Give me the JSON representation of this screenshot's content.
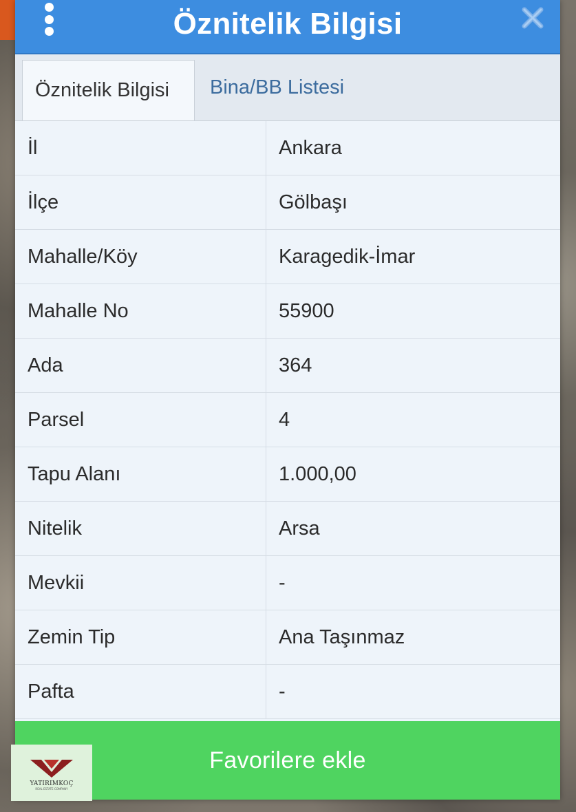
{
  "dialog": {
    "title": "Öznitelik Bilgisi",
    "menu_icon": "kebab-menu-icon",
    "close_icon": "close-icon"
  },
  "tabs": [
    {
      "label": "Öznitelik Bilgisi",
      "active": true
    },
    {
      "label": "Bina/BB Listesi",
      "active": false
    }
  ],
  "attributes": [
    {
      "key": "İl",
      "value": "Ankara"
    },
    {
      "key": "İlçe",
      "value": "Gölbaşı"
    },
    {
      "key": "Mahalle/Köy",
      "value": "Karagedik-İmar"
    },
    {
      "key": "Mahalle No",
      "value": "55900"
    },
    {
      "key": "Ada",
      "value": "364"
    },
    {
      "key": "Parsel",
      "value": "4"
    },
    {
      "key": "Tapu Alanı",
      "value": "1.000,00"
    },
    {
      "key": "Nitelik",
      "value": "Arsa"
    },
    {
      "key": "Mevkii",
      "value": "-"
    },
    {
      "key": "Zemin Tip",
      "value": "Ana Taşınmaz"
    },
    {
      "key": "Pafta",
      "value": "-"
    }
  ],
  "favorite_button": {
    "label": "Favorilere ekle"
  },
  "logo": {
    "name": "YATIRIMKOÇ",
    "tagline": "REAL ESTATE COMPANY"
  },
  "colors": {
    "header": "#3d8de0",
    "button": "#4fd460",
    "tab_inactive_text": "#3c6c9e"
  }
}
